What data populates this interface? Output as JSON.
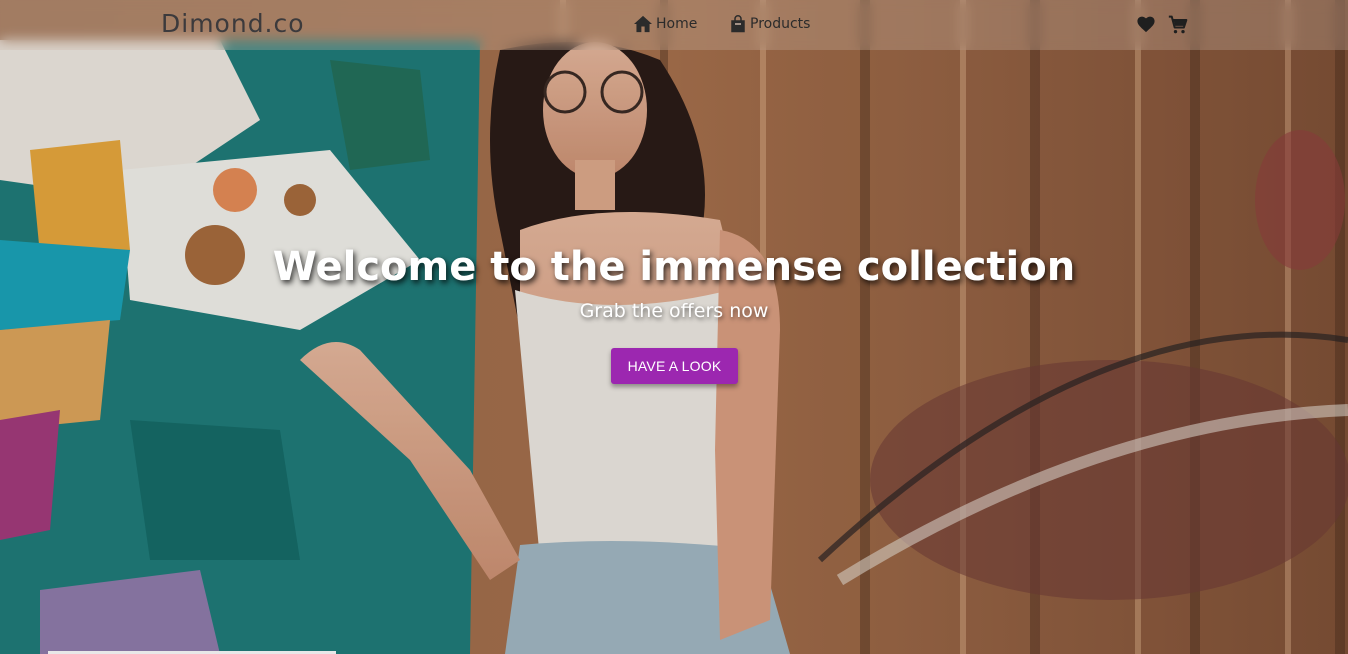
{
  "navbar": {
    "brand": "Dimond.co",
    "links": [
      {
        "label": "Home",
        "icon": "home-icon"
      },
      {
        "label": "Products",
        "icon": "shopping-bag-icon"
      }
    ],
    "actions": [
      {
        "icon": "heart-icon"
      },
      {
        "icon": "cart-icon"
      }
    ]
  },
  "hero": {
    "title": "Welcome to the immense collection",
    "subtitle": "Grab the offers now",
    "cta_label": "HAVE A LOOK"
  },
  "colors": {
    "accent": "#9c27b0",
    "text_light": "#ffffff",
    "nav_text": "#2b2b2b"
  }
}
